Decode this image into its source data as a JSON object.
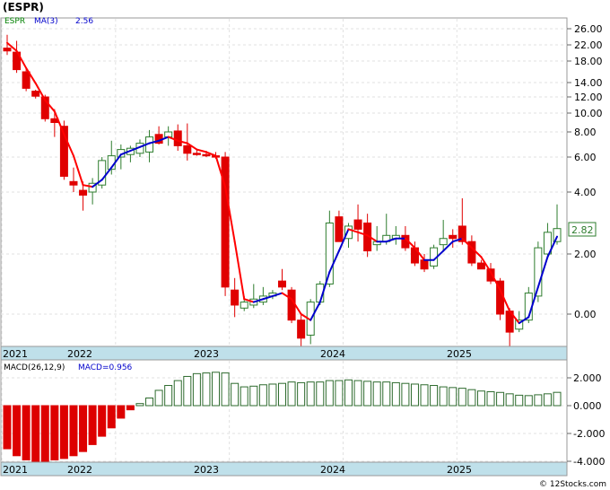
{
  "title": "(ESPR)",
  "watermark": "© 12Stocks.com",
  "price_panel": {
    "symbol_label": "ESPR",
    "ma_label": "MA(3)",
    "ma_value": "2.56",
    "last_price": "2.82",
    "y_ticks": [
      "26.00",
      "22.00",
      "18.00",
      "14.00",
      "12.00",
      "10.00",
      "8.00",
      "6.00",
      "4.00",
      "2.00",
      "0.00"
    ]
  },
  "macd_panel": {
    "label": "MACD(26,12,9)",
    "value_label": "MACD=0.956",
    "y_ticks": [
      "2.000",
      "0.000",
      "-2.000",
      "-4.000"
    ]
  },
  "x_labels": [
    "2021",
    "2022",
    "2023",
    "2024",
    "2025"
  ],
  "colors": {
    "up": "#2e7d2e",
    "down": "#e00000",
    "ma": "#0000cc",
    "ma_signal": "#ff0000",
    "macd_pos": "#2e6b2e",
    "macd_neg": "#dd0000",
    "axis_band": "#bfe0ea",
    "label_green": "#008000",
    "label_blue": "#0000cc"
  },
  "chart_data": [
    {
      "type": "candlestick",
      "title": "(ESPR)",
      "period": "monthly",
      "x_labels": [
        "2021",
        "2022",
        "2023",
        "2024",
        "2025"
      ],
      "y_scale": "custom (non-linear price axis)",
      "ylim": [
        -1.6,
        28
      ],
      "series": [
        {
          "name": "ESPR",
          "ohlc": [
            [
              21.2,
              24.5,
              19.5,
              20.5
            ],
            [
              20.2,
              23.0,
              15.8,
              16.4
            ],
            [
              16.0,
              16.5,
              12.8,
              13.2
            ],
            [
              12.8,
              13.0,
              11.8,
              12.1
            ],
            [
              12.0,
              12.3,
              9.1,
              9.4
            ],
            [
              9.4,
              10.5,
              7.6,
              9.0
            ],
            [
              8.6,
              9.2,
              4.7,
              4.9
            ],
            [
              4.6,
              5.4,
              4.0,
              4.4
            ],
            [
              4.1,
              4.6,
              3.4,
              3.9
            ],
            [
              4.0,
              4.8,
              3.6,
              4.5
            ],
            [
              4.4,
              6.0,
              4.2,
              5.8
            ],
            [
              5.3,
              7.3,
              5.0,
              6.1
            ],
            [
              6.0,
              7.0,
              5.3,
              6.6
            ],
            [
              6.2,
              6.9,
              5.7,
              6.7
            ],
            [
              6.3,
              7.4,
              6.0,
              7.1
            ],
            [
              6.4,
              8.2,
              5.7,
              7.6
            ],
            [
              7.8,
              8.6,
              7.0,
              7.1
            ],
            [
              7.6,
              8.6,
              6.9,
              8.0
            ],
            [
              8.1,
              8.8,
              6.5,
              6.9
            ],
            [
              6.9,
              8.9,
              5.8,
              6.3
            ],
            [
              6.3,
              6.6,
              6.1,
              6.2
            ],
            [
              6.2,
              6.5,
              6.0,
              6.1
            ],
            [
              6.1,
              6.4,
              5.9,
              6.0
            ],
            [
              6.0,
              6.4,
              0.6,
              0.9
            ],
            [
              0.8,
              1.2,
              -0.1,
              0.3
            ],
            [
              0.2,
              0.6,
              0.1,
              0.4
            ],
            [
              0.3,
              1.0,
              0.2,
              0.5
            ],
            [
              0.4,
              0.9,
              0.3,
              0.6
            ],
            [
              0.6,
              0.8,
              0.5,
              0.7
            ],
            [
              1.1,
              1.5,
              0.8,
              0.9
            ],
            [
              0.8,
              0.9,
              -0.3,
              -0.2
            ],
            [
              -0.2,
              0.0,
              -1.6,
              -0.8
            ],
            [
              -0.7,
              0.5,
              -1.0,
              0.4
            ],
            [
              0.4,
              1.1,
              0.3,
              1.0
            ],
            [
              1.0,
              3.4,
              0.9,
              3.0
            ],
            [
              3.2,
              3.4,
              2.4,
              2.4
            ],
            [
              2.5,
              3.0,
              2.2,
              2.9
            ],
            [
              3.1,
              3.6,
              2.4,
              2.8
            ],
            [
              3.0,
              3.3,
              1.9,
              2.1
            ],
            [
              2.3,
              2.9,
              2.1,
              2.4
            ],
            [
              2.4,
              3.3,
              2.3,
              2.6
            ],
            [
              2.5,
              2.9,
              2.3,
              2.6
            ],
            [
              2.6,
              2.9,
              2.1,
              2.2
            ],
            [
              2.2,
              2.4,
              1.6,
              1.7
            ],
            [
              1.8,
              2.0,
              1.4,
              1.5
            ],
            [
              1.6,
              2.3,
              1.5,
              2.2
            ],
            [
              2.3,
              3.1,
              2.1,
              2.5
            ],
            [
              2.6,
              2.8,
              2.2,
              2.5
            ],
            [
              2.9,
              3.8,
              2.3,
              2.4
            ],
            [
              2.4,
              2.6,
              1.6,
              1.7
            ],
            [
              1.7,
              1.8,
              1.5,
              1.5
            ],
            [
              1.5,
              1.7,
              1.0,
              1.1
            ],
            [
              1.1,
              1.2,
              -0.2,
              0.0
            ],
            [
              0.1,
              0.2,
              -1.2,
              -0.6
            ],
            [
              -0.5,
              0.1,
              -0.6,
              -0.2
            ],
            [
              -0.2,
              0.9,
              -0.3,
              0.7
            ],
            [
              0.6,
              2.4,
              0.4,
              2.2
            ],
            [
              2.0,
              3.0,
              1.9,
              2.7
            ],
            [
              2.4,
              3.6,
              2.3,
              2.82
            ]
          ]
        },
        {
          "name": "MA(3)",
          "values": [
            22.5,
            20.5,
            16.7,
            13.9,
            11.6,
            10.2,
            7.8,
            6.1,
            4.4,
            4.3,
            4.7,
            5.4,
            6.2,
            6.5,
            6.8,
            7.1,
            7.3,
            7.6,
            7.3,
            7.1,
            6.6,
            6.4,
            6.1,
            4.3,
            2.4,
            0.5,
            0.4,
            0.5,
            0.6,
            0.7,
            0.5,
            0.0,
            -0.2,
            0.4,
            1.4,
            2.1,
            2.8,
            2.7,
            2.6,
            2.4,
            2.4,
            2.5,
            2.5,
            2.2,
            1.8,
            1.8,
            2.1,
            2.4,
            2.5,
            2.2,
            1.9,
            1.4,
            0.8,
            0.1,
            -0.3,
            -0.1,
            0.9,
            1.9,
            2.56
          ]
        }
      ]
    },
    {
      "type": "bar",
      "title": "MACD(26,12,9)",
      "value_label": "MACD=0.956",
      "ylim": [
        -4.0,
        2.4
      ],
      "values": [
        -3.1,
        -3.6,
        -3.9,
        -4.0,
        -4.0,
        -3.9,
        -3.8,
        -3.6,
        -3.3,
        -2.8,
        -2.2,
        -1.6,
        -0.9,
        -0.3,
        0.15,
        0.55,
        1.1,
        1.45,
        1.8,
        2.1,
        2.3,
        2.35,
        2.4,
        2.35,
        1.6,
        1.35,
        1.4,
        1.5,
        1.55,
        1.6,
        1.7,
        1.65,
        1.7,
        1.7,
        1.8,
        1.8,
        1.85,
        1.8,
        1.75,
        1.7,
        1.7,
        1.65,
        1.6,
        1.55,
        1.5,
        1.45,
        1.35,
        1.3,
        1.25,
        1.15,
        1.05,
        1.0,
        0.95,
        0.85,
        0.75,
        0.72,
        0.78,
        0.85,
        0.956
      ]
    }
  ]
}
